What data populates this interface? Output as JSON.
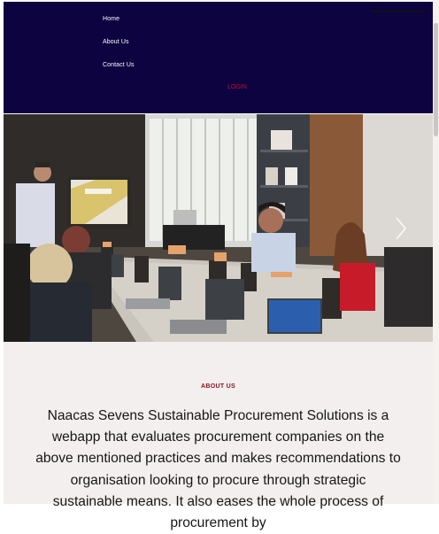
{
  "nav": {
    "links": [
      "Home",
      "About Us",
      "Contact Us"
    ],
    "login": "LOGIN"
  },
  "hero": {
    "next_icon": "chevron-right-icon"
  },
  "about": {
    "heading": "ABOUT US",
    "text": "Naacas Sevens Sustainable Procurement Solutions is a webapp that evaluates procurement companies on the above mentioned practices and makes recommendations to organisation looking to procure through strategic sustainable means. It also eases the whole process of procurement by"
  },
  "colors": {
    "nav_background": "#0d0340",
    "nav_text": "#ffffff",
    "login_accent": "#c80f2b",
    "about_heading": "#8b1019",
    "about_background": "#f3efee"
  }
}
